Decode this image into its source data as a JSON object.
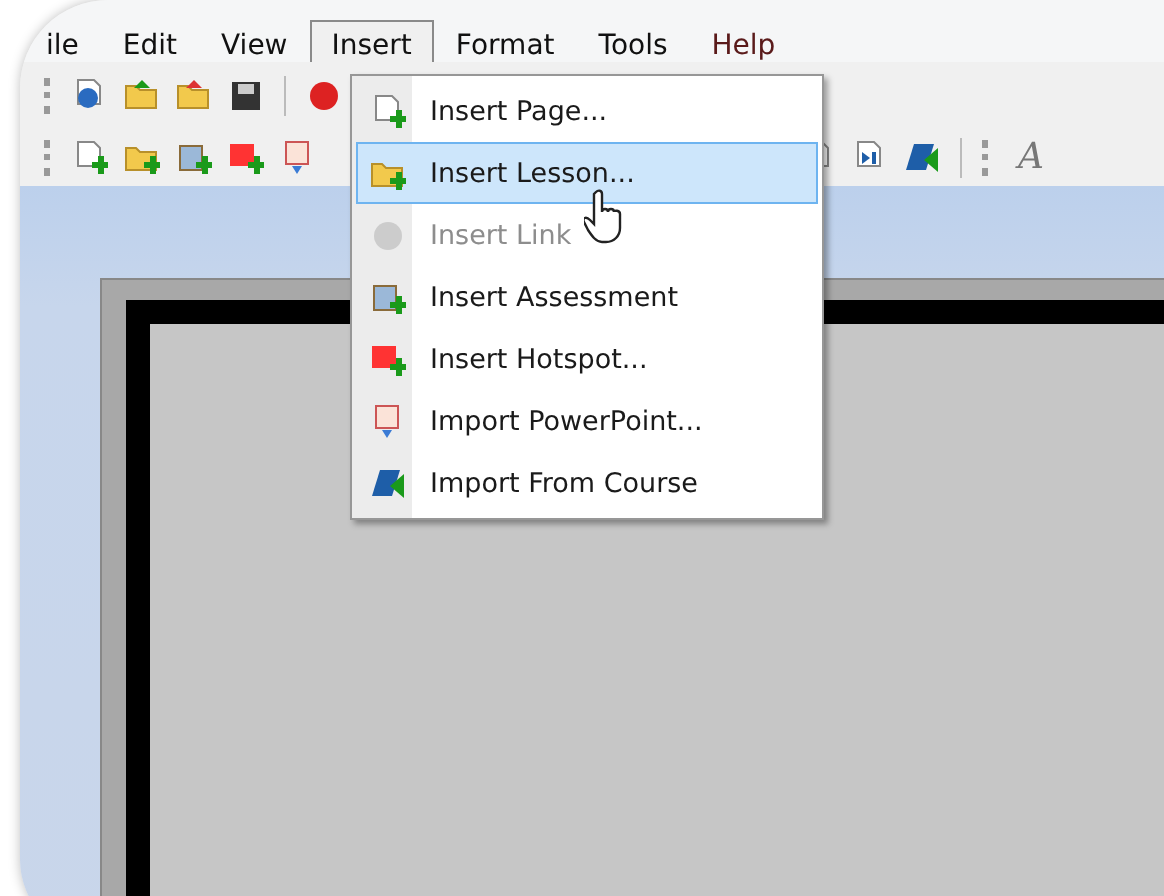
{
  "menu_bar": [
    {
      "label": "ile",
      "selected": false
    },
    {
      "label": "Edit",
      "selected": false
    },
    {
      "label": "View",
      "selected": false
    },
    {
      "label": "Insert",
      "selected": true
    },
    {
      "label": "Format",
      "selected": false
    },
    {
      "label": "Tools",
      "selected": false
    },
    {
      "label": "Help",
      "selected": false
    }
  ],
  "insert_menu": [
    {
      "label": "Insert Page...",
      "selected": false,
      "disabled": false
    },
    {
      "label": "Insert Lesson...",
      "selected": true,
      "disabled": false
    },
    {
      "label": "Insert Link",
      "selected": false,
      "disabled": true
    },
    {
      "label": "Insert Assessment",
      "selected": false,
      "disabled": false
    },
    {
      "label": "Insert Hotspot...",
      "selected": false,
      "disabled": false
    },
    {
      "label": "Import PowerPoint...",
      "selected": false,
      "disabled": false
    },
    {
      "label": "Import From Course",
      "selected": false,
      "disabled": false
    }
  ],
  "toolbar_text_tool": "A"
}
